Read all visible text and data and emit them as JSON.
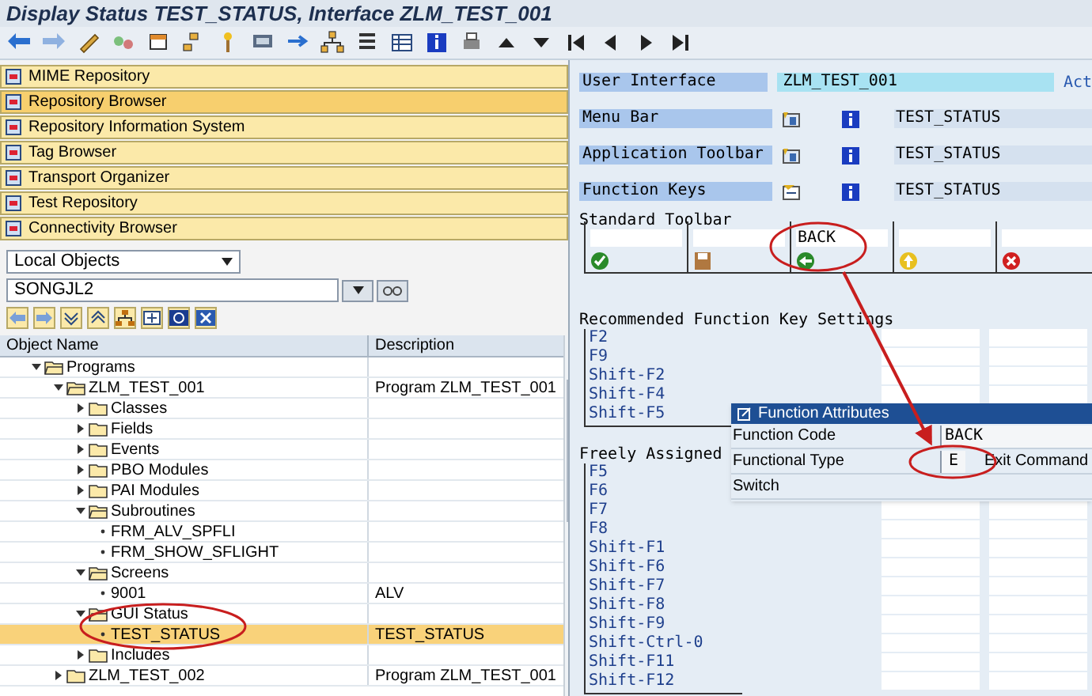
{
  "window": {
    "title": "Display Status TEST_STATUS, Interface ZLM_TEST_001"
  },
  "navigator": [
    {
      "label": "MIME Repository",
      "selected": false
    },
    {
      "label": "Repository Browser",
      "selected": true
    },
    {
      "label": "Repository Information System",
      "selected": false
    },
    {
      "label": "Tag Browser",
      "selected": false
    },
    {
      "label": "Transport Organizer",
      "selected": false
    },
    {
      "label": "Test Repository",
      "selected": false
    },
    {
      "label": "Connectivity Browser",
      "selected": false
    }
  ],
  "object_list": {
    "type": "Local Objects",
    "user": "SONGJL2"
  },
  "tree": {
    "columns": [
      "Object Name",
      "Description"
    ],
    "rows": [
      {
        "kind": "folder",
        "label": "Programs",
        "expanded": true,
        "selected": false,
        "children": [
          {
            "kind": "folder",
            "label": "ZLM_TEST_001",
            "description": "Program ZLM_TEST_001",
            "expanded": true,
            "selected": false,
            "children": [
              {
                "kind": "folder",
                "label": "Classes",
                "expanded": false,
                "selected": false
              },
              {
                "kind": "folder",
                "label": "Fields",
                "expanded": false,
                "selected": false
              },
              {
                "kind": "folder",
                "label": "Events",
                "expanded": false,
                "selected": false
              },
              {
                "kind": "folder",
                "label": "PBO Modules",
                "expanded": false,
                "selected": false
              },
              {
                "kind": "folder",
                "label": "PAI Modules",
                "expanded": false,
                "selected": false
              },
              {
                "kind": "folder",
                "label": "Subroutines",
                "expanded": true,
                "selected": false,
                "children": [
                  {
                    "kind": "leaf",
                    "label": "FRM_ALV_SPFLI",
                    "selected": false
                  },
                  {
                    "kind": "leaf",
                    "label": "FRM_SHOW_SFLIGHT",
                    "selected": false
                  }
                ]
              },
              {
                "kind": "folder",
                "label": "Screens",
                "expanded": true,
                "selected": false,
                "children": [
                  {
                    "kind": "leaf",
                    "label": "9001",
                    "description": "ALV",
                    "selected": false
                  }
                ]
              },
              {
                "kind": "folder",
                "label": "GUI Status",
                "expanded": true,
                "selected": false,
                "children": [
                  {
                    "kind": "leaf",
                    "label": "TEST_STATUS",
                    "description": "TEST_STATUS",
                    "selected": true
                  }
                ]
              },
              {
                "kind": "folder",
                "label": "Includes",
                "expanded": false,
                "selected": false
              }
            ]
          },
          {
            "kind": "folder",
            "label": "ZLM_TEST_002",
            "description": "Program ZLM_TEST_001",
            "expanded": false,
            "selected": false
          }
        ]
      }
    ]
  },
  "interface": {
    "label": "User Interface",
    "value": "ZLM_TEST_001",
    "status": "Act",
    "components": [
      {
        "kind": "menu",
        "label": "Menu Bar",
        "value": "TEST_STATUS"
      },
      {
        "kind": "menu",
        "label": "Application Toolbar",
        "value": "TEST_STATUS"
      },
      {
        "kind": "keys",
        "label": "Function Keys",
        "value": "TEST_STATUS"
      }
    ],
    "standard_toolbar": {
      "title": "Standard Toolbar",
      "buttons": [
        {
          "kind": "check"
        },
        {
          "kind": "save"
        },
        {
          "kind": "back",
          "code": "BACK"
        },
        {
          "kind": "up"
        },
        {
          "kind": "cancel"
        }
      ]
    },
    "recommended_keys": {
      "title": "Recommended Function Key Settings",
      "keys": [
        "F2",
        "F9",
        "Shift-F2",
        "Shift-F4",
        "Shift-F5"
      ]
    },
    "free_keys": {
      "title": "Freely Assigned",
      "keys": [
        "F5",
        "F6",
        "F7",
        "F8",
        "Shift-F1",
        "Shift-F6",
        "Shift-F7",
        "Shift-F8",
        "Shift-F9",
        "Shift-Ctrl-0",
        "Shift-F11",
        "Shift-F12"
      ]
    }
  },
  "dialog": {
    "title": "Function Attributes",
    "fields": [
      {
        "label": "Function Code",
        "value": "BACK"
      },
      {
        "label": "Functional Type",
        "value": "E",
        "text": "Exit Command"
      },
      {
        "label": "Switch"
      }
    ]
  }
}
